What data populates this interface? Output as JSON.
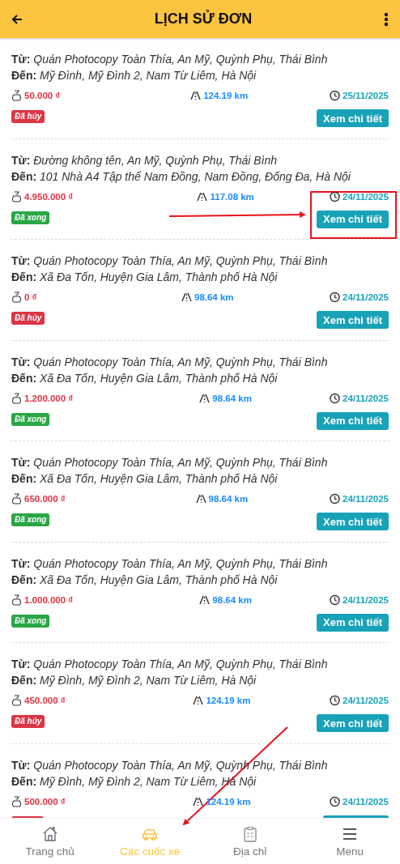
{
  "header": {
    "title": "LỊCH SỬ ĐƠN"
  },
  "orders": [
    {
      "from_label": "Từ:",
      "from": "Quán Photocopy Toàn Thía, An Mỹ, Quỳnh Phụ, Thái Bình",
      "to_label": "Đến:",
      "to": "Mỹ Đình, Mỹ Đình 2, Nam Từ Liêm, Hà Nội",
      "price": "50.000 ₫",
      "distance": "124.19 km",
      "date": "25/11/2025",
      "status": {
        "kind": "cancelled",
        "label": "Đã hủy"
      },
      "button": "Xem chi tiết"
    },
    {
      "from_label": "Từ:",
      "from": "Đường không tên, An Mỹ, Quỳnh Phụ, Thái Bình",
      "to_label": "Đến:",
      "to": "101 Nhà A4 Tập thể Nam Đồng, Nam Đồng, Đống Đa, Hà Nội",
      "price": "4.950.000 ₫",
      "distance": "117.08 km",
      "date": "24/11/2025",
      "status": {
        "kind": "done",
        "label": "Đã xong"
      },
      "button": "Xem chi tiết"
    },
    {
      "from_label": "Từ:",
      "from": "Quán Photocopy Toàn Thía, An Mỹ, Quỳnh Phụ, Thái Bình",
      "to_label": "Đến:",
      "to": "Xã Đa Tốn, Huyện Gia Lâm, Thành phố Hà Nội",
      "price": "0 ₫",
      "distance": "98.64 km",
      "date": "24/11/2025",
      "status": {
        "kind": "cancelled",
        "label": "Đã hủy"
      },
      "button": "Xem chi tiết"
    },
    {
      "from_label": "Từ:",
      "from": "Quán Photocopy Toàn Thía, An Mỹ, Quỳnh Phụ, Thái Bình",
      "to_label": "Đến:",
      "to": "Xã Đa Tốn, Huyện Gia Lâm, Thành phố Hà Nội",
      "price": "1.200.000 ₫",
      "distance": "98.64 km",
      "date": "24/11/2025",
      "status": {
        "kind": "done",
        "label": "Đã xong"
      },
      "button": "Xem chi tiết"
    },
    {
      "from_label": "Từ:",
      "from": "Quán Photocopy Toàn Thía, An Mỹ, Quỳnh Phụ, Thái Bình",
      "to_label": "Đến:",
      "to": "Xã Đa Tốn, Huyện Gia Lâm, Thành phố Hà Nội",
      "price": "650.000 ₫",
      "distance": "98.64 km",
      "date": "24/11/2025",
      "status": {
        "kind": "done",
        "label": "Đã xong"
      },
      "button": "Xem chi tiết"
    },
    {
      "from_label": "Từ:",
      "from": "Quán Photocopy Toàn Thía, An Mỹ, Quỳnh Phụ, Thái Bình",
      "to_label": "Đến:",
      "to": "Xã Đa Tốn, Huyện Gia Lâm, Thành phố Hà Nội",
      "price": "1.000.000 ₫",
      "distance": "98.64 km",
      "date": "24/11/2025",
      "status": {
        "kind": "done",
        "label": "Đã xong"
      },
      "button": "Xem chi tiết"
    },
    {
      "from_label": "Từ:",
      "from": "Quán Photocopy Toàn Thía, An Mỹ, Quỳnh Phụ, Thái Bình",
      "to_label": "Đến:",
      "to": "Mỹ Đình, Mỹ Đình 2, Nam Từ Liêm, Hà Nội",
      "price": "450.000 ₫",
      "distance": "124.19 km",
      "date": "24/11/2025",
      "status": {
        "kind": "cancelled",
        "label": "Đã hủy"
      },
      "button": "Xem chi tiết"
    },
    {
      "from_label": "Từ:",
      "from": "Quán Photocopy Toàn Thía, An Mỹ, Quỳnh Phụ, Thái Bình",
      "to_label": "Đến:",
      "to": "Mỹ Đình, Mỹ Đình 2, Nam Từ Liêm, Hà Nội",
      "price": "500.000 ₫",
      "distance": "124.19 km",
      "date": "24/11/2025",
      "status": {
        "kind": "cancelled"
      }
    }
  ],
  "bottom_nav": [
    {
      "kind": "home",
      "label": "Trang chủ",
      "selected": false
    },
    {
      "kind": "car",
      "label": "Các cuốc xe",
      "selected": true
    },
    {
      "kind": "clipboard",
      "label": "Địa chỉ",
      "selected": false
    },
    {
      "kind": "menu",
      "label": "Menu",
      "selected": false
    }
  ],
  "annotations": [
    {
      "kind": "box"
    },
    {
      "kind": "arrow"
    },
    {
      "kind": "arrow"
    }
  ]
}
